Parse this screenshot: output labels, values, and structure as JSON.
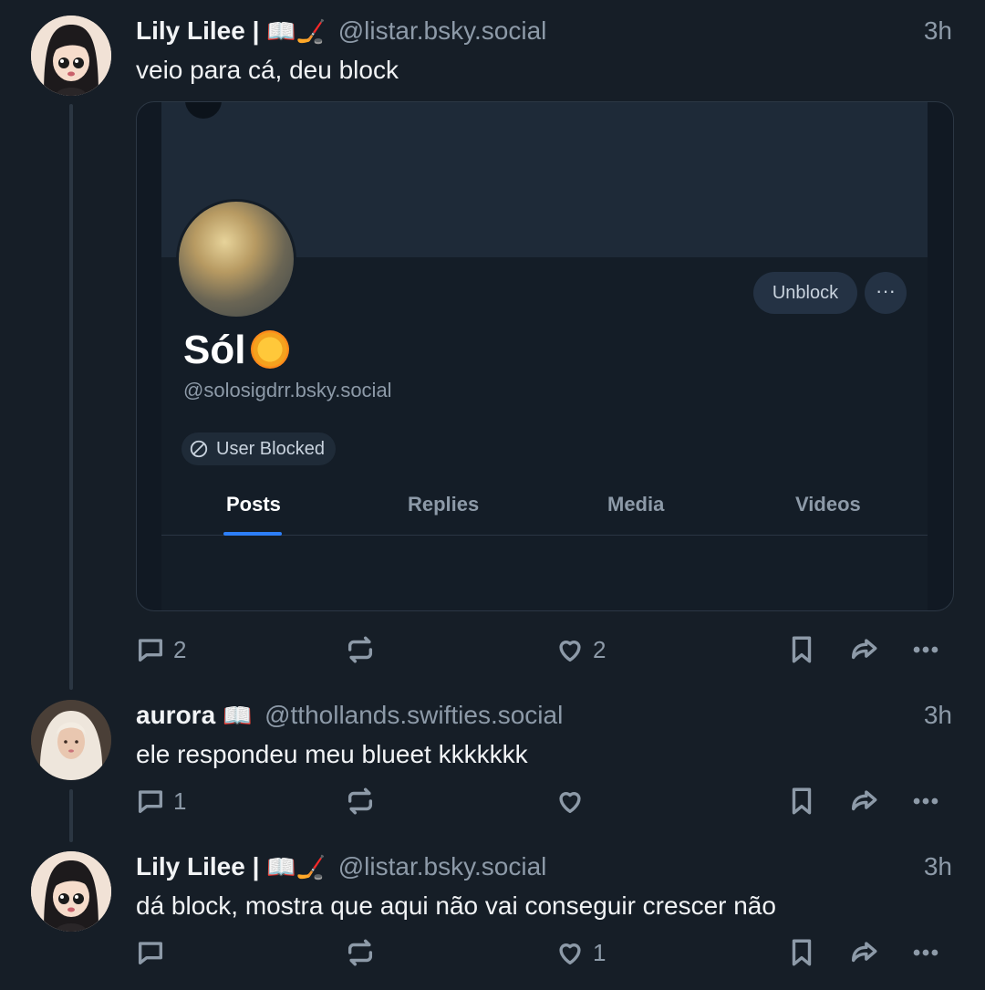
{
  "posts": [
    {
      "author_name": "Lily Lilee |",
      "author_emoji": "📖🏒",
      "handle": "@listar.bsky.social",
      "time": "3h",
      "text": "veio para cá, deu block",
      "reply_count": "2",
      "repost_count": "",
      "like_count": "2"
    },
    {
      "author_name": "aurora",
      "author_emoji": "📖",
      "handle": "@tthollands.swifties.social",
      "time": "3h",
      "text": "ele respondeu meu blueet kkkkkkk",
      "reply_count": "1",
      "repost_count": "",
      "like_count": ""
    },
    {
      "author_name": "Lily Lilee |",
      "author_emoji": "📖🏒",
      "handle": "@listar.bsky.social",
      "time": "3h",
      "text": "dá block, mostra que aqui não vai conseguir crescer não",
      "reply_count": "",
      "repost_count": "",
      "like_count": "1"
    }
  ],
  "embed": {
    "profile_name": "Sól",
    "profile_handle": "@solosigdrr.bsky.social",
    "unblock_label": "Unblock",
    "more_label": "···",
    "blocked_label": "User Blocked",
    "tabs": [
      "Posts",
      "Replies",
      "Media",
      "Videos"
    ],
    "active_tab": "Posts"
  },
  "colors": {
    "background": "#161e27",
    "muted": "#8d9aa8",
    "accent": "#2d7ff9"
  },
  "icons": [
    "reply-icon",
    "repost-icon",
    "like-icon",
    "bookmark-icon",
    "share-icon",
    "more-icon",
    "block-icon"
  ]
}
